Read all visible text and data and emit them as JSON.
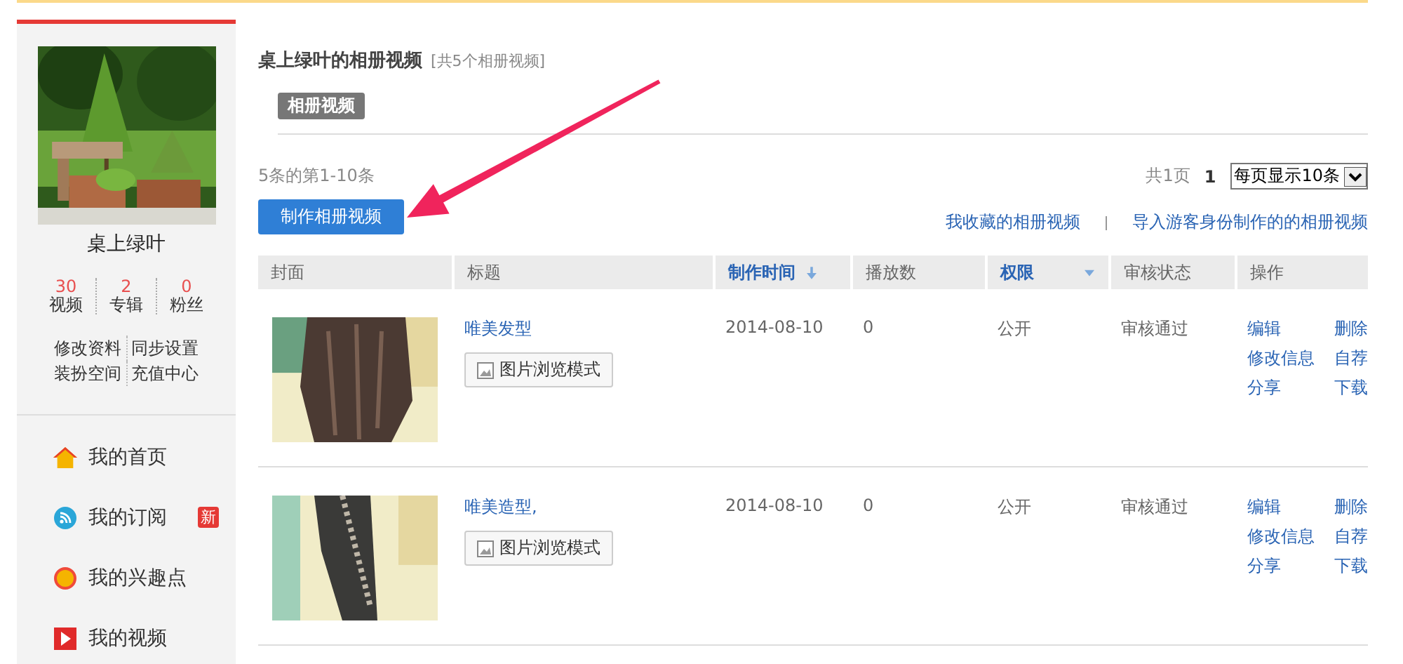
{
  "sidebar": {
    "user_name": "桌上绿叶",
    "stats": [
      {
        "value": "30",
        "label": "视频"
      },
      {
        "value": "2",
        "label": "专辑"
      },
      {
        "value": "0",
        "label": "粉丝"
      }
    ],
    "links": [
      "修改资料",
      "同步设置",
      "装扮空间",
      "充值中心"
    ],
    "nav": [
      {
        "label": "我的首页",
        "kind": "home"
      },
      {
        "label": "我的订阅",
        "kind": "rss",
        "badge": "新"
      },
      {
        "label": "我的兴趣点",
        "kind": "dot"
      },
      {
        "label": "我的视频",
        "kind": "play"
      }
    ]
  },
  "main": {
    "title": "桌上绿叶的相册视频",
    "count_note": "[共5个相册视频]",
    "tabs": [
      {
        "label": "相册视频",
        "selected": true
      }
    ],
    "range_text": "5条的第1-10条",
    "total_pages": "共1页",
    "current_page": "1",
    "page_size": "每页显示10条",
    "create_button": "制作相册视频",
    "links": [
      "我收藏的相册视频",
      "导入游客身份制作的的相册视频"
    ],
    "table": {
      "columns": [
        {
          "label": "封面",
          "kind": "plain"
        },
        {
          "label": "标题",
          "kind": "plain"
        },
        {
          "label": "制作时间",
          "kind": "sort"
        },
        {
          "label": "播放数",
          "kind": "plain"
        },
        {
          "label": "权限",
          "kind": "filter"
        },
        {
          "label": "审核状态",
          "kind": "plain"
        },
        {
          "label": "操作",
          "kind": "plain"
        }
      ],
      "rows": [
        {
          "kind": "hair",
          "title": "唯美发型",
          "view_button": "图片浏览模式",
          "date": "2014-08-10",
          "plays": "0",
          "access": "公开",
          "review": "审核通过",
          "actions": [
            "编辑",
            "删除",
            "修改信息",
            "自荐",
            "分享",
            "下载"
          ]
        },
        {
          "kind": "braid",
          "title": "唯美造型,",
          "view_button": "图片浏览模式",
          "date": "2014-08-10",
          "plays": "0",
          "access": "公开",
          "review": "审核通过",
          "actions": [
            "编辑",
            "删除",
            "修改信息",
            "自荐",
            "分享",
            "下载"
          ]
        }
      ]
    }
  }
}
